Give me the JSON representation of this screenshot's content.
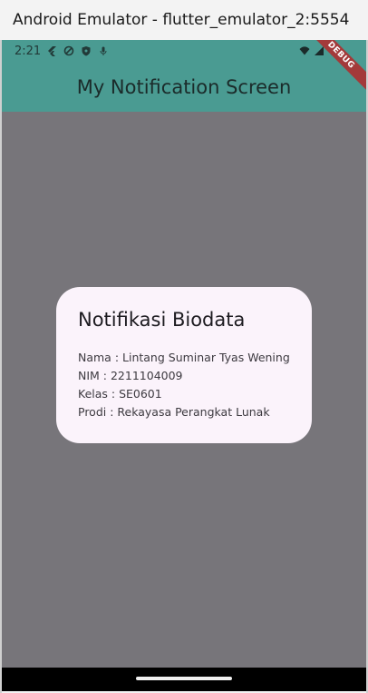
{
  "window": {
    "title": "Android Emulator - flutter_emulator_2:5554"
  },
  "statusbar": {
    "time": "2:21",
    "icons_left": [
      "flutter-icon",
      "block-icon",
      "shield-icon",
      "mic-icon"
    ],
    "icons_right": [
      "wifi-icon",
      "signal-icon",
      "battery-icon"
    ]
  },
  "appbar": {
    "title": "My Notification Screen"
  },
  "debug_banner": {
    "label": "DEBUG"
  },
  "dialog": {
    "title": "Notifikasi Biodata",
    "lines": [
      "Nama : Lintang Suminar Tyas Wening",
      "NIM : 2211104009",
      "Kelas : SE0601",
      "Prodi : Rekayasa Perangkat Lunak"
    ]
  },
  "colors": {
    "appbar": "#4a9b92",
    "scrim": "#77757a",
    "dialog_bg": "#fbf3fb",
    "debug_ribbon": "#a33a3a"
  }
}
